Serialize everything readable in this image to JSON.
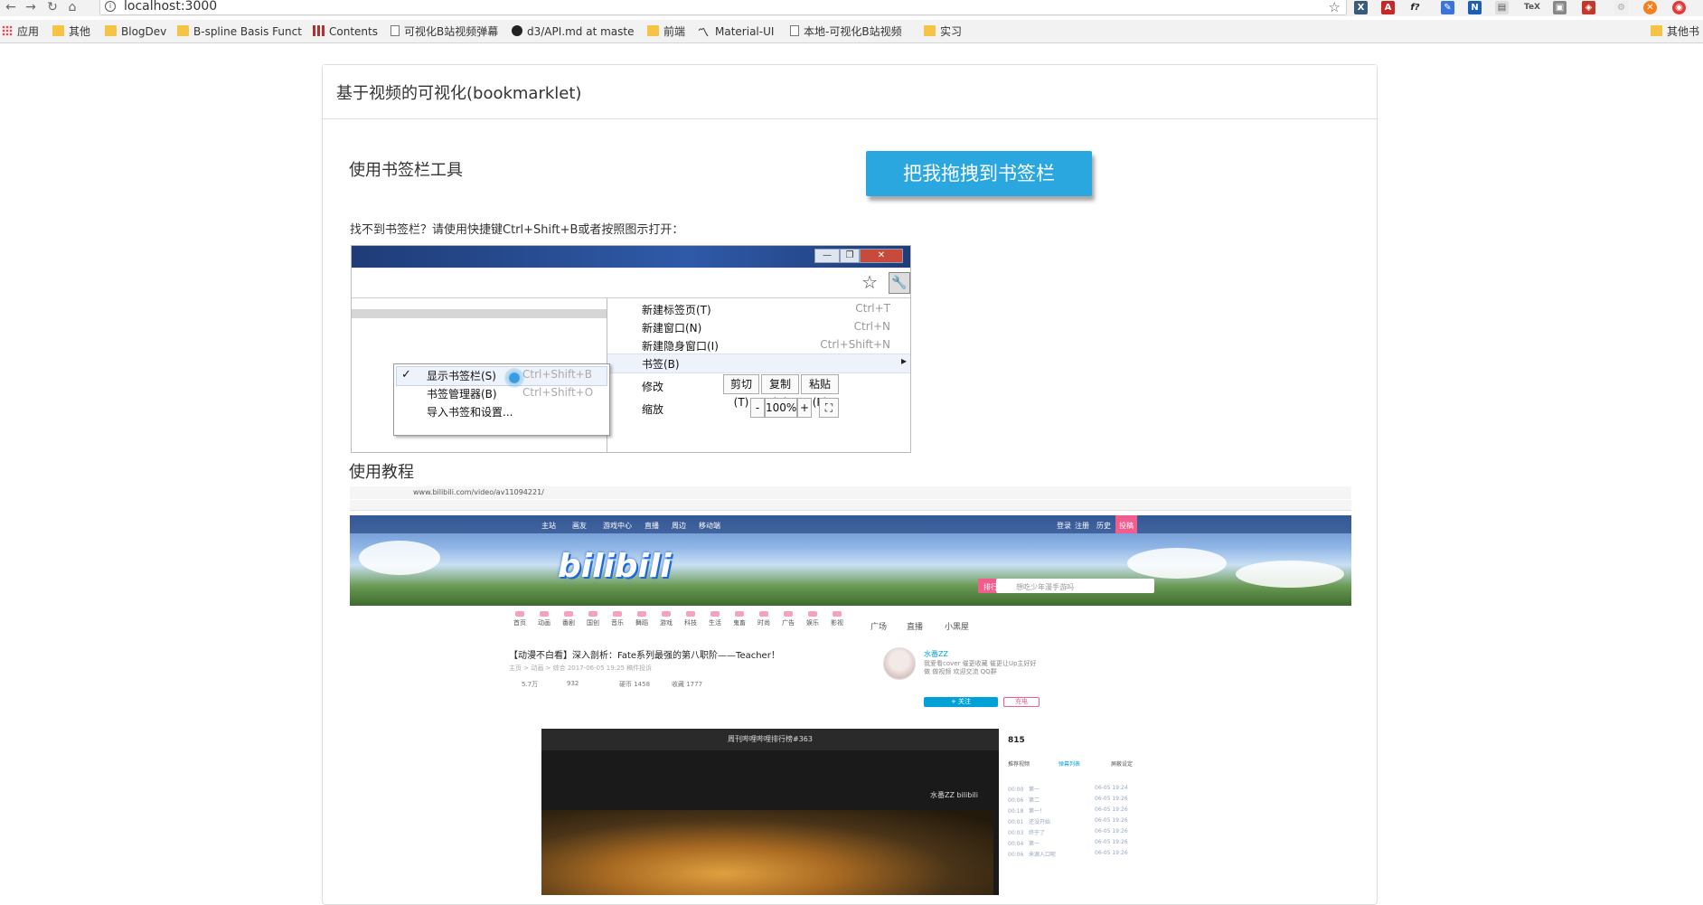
{
  "browser": {
    "url": "localhost:3000",
    "bookmarks": [
      {
        "label": "应用",
        "icon": "apps-icon"
      },
      {
        "label": "其他",
        "icon": "folder-icon"
      },
      {
        "label": "BlogDev",
        "icon": "folder-icon"
      },
      {
        "label": "B-spline Basis Funct",
        "icon": "folder-icon"
      },
      {
        "label": "Contents",
        "icon": "book-icon"
      },
      {
        "label": "可视化B站视频弹幕",
        "icon": "page-icon"
      },
      {
        "label": "d3/API.md at maste",
        "icon": "github-icon"
      },
      {
        "label": "前端",
        "icon": "folder-icon"
      },
      {
        "label": "Material-UI",
        "icon": "material-ui-icon"
      },
      {
        "label": "本地-可视化B站视频",
        "icon": "page-icon"
      },
      {
        "label": "实习",
        "icon": "folder-icon"
      }
    ],
    "other_bookmarks": "其他书"
  },
  "panel": {
    "title": "基于视频的可视化(bookmarklet)"
  },
  "bookmarklet": {
    "heading": "使用书签栏工具",
    "button_label": "把我拖拽到书签栏",
    "hint": "找不到书签栏？请使用快捷键Ctrl+Shift+B或者按照图示打开："
  },
  "illustration": {
    "menu_items": [
      {
        "label": "新建标签页(T)",
        "shortcut": "Ctrl+T"
      },
      {
        "label": "新建窗口(N)",
        "shortcut": "Ctrl+N"
      },
      {
        "label": "新建隐身窗口(I)",
        "shortcut": "Ctrl+Shift+N"
      },
      {
        "label": "书签(B)",
        "shortcut": ""
      }
    ],
    "edit_label": "修改",
    "edit_buttons": [
      "剪切(T)",
      "复制(C)",
      "粘贴(P)"
    ],
    "zoom_label": "缩放",
    "zoom_minus": "-",
    "zoom_value": "100%",
    "zoom_plus": "+",
    "submenu": [
      {
        "label": "显示书签栏(S)",
        "shortcut": "Ctrl+Shift+B",
        "checked": true
      },
      {
        "label": "书签管理器(B)",
        "shortcut": "Ctrl+Shift+O"
      },
      {
        "label": "导入书签和设置..."
      }
    ],
    "check_mark": "✓",
    "submenu_arrow": "▸"
  },
  "tutorial": {
    "heading": "使用教程",
    "url": "www.bilibili.com/video/av11094221/",
    "nav": [
      "主站",
      "画友",
      "游戏中心",
      "直播",
      "周边",
      "移动端"
    ],
    "nav_right": [
      "登录",
      "注册",
      "历史",
      "投稿"
    ],
    "logo": "bilibili",
    "search_placeholder": "想吃少年漫手游吗",
    "rank_label": "排行榜",
    "categories": [
      "首页",
      "动画",
      "番剧",
      "国创",
      "音乐",
      "舞蹈",
      "游戏",
      "科技",
      "生活",
      "鬼畜",
      "时尚",
      "广告",
      "娱乐",
      "影视"
    ],
    "extras": [
      "广场",
      "直播",
      "小黑屋"
    ],
    "video_title": "【动漫不白看】深入剖析：Fate系列最强的第八职阶——Teacher！",
    "video_meta": "主页 > 动画 > 综合     2017-06-05 19:25     稿件投诉",
    "stats": [
      "5.7万",
      "932",
      "硬币 1458",
      "收藏 1777"
    ],
    "uploader": "水番ZZ",
    "uploader_desc": "我爱看cover 催更收藏 催更让Up主好好做 做视频 欢迎交流 QQ群",
    "follow_label": "+ 关注",
    "charge_label": "充电",
    "player_title": "周刊哔哩哔哩排行榜#363",
    "watermark": "水番ZZ  bilibili",
    "danmaku_count": "815",
    "danmaku_tabs": [
      "推荐视频",
      "弹幕列表",
      "屏蔽设定"
    ],
    "danmaku_rows": [
      [
        "00:00",
        "第一",
        "06-05 19:24"
      ],
      [
        "00:06",
        "第二",
        "06-05 19:26"
      ],
      [
        "00:18",
        "第一！",
        "06-05 19:26"
      ],
      [
        "00:01",
        "还没开始",
        "06-05 19:26"
      ],
      [
        "00:03",
        "终于了",
        "06-05 19:26"
      ],
      [
        "00:04",
        "第一",
        "06-05 19:26"
      ],
      [
        "00:06",
        "来源入口呢",
        "06-05 19:26"
      ]
    ]
  }
}
